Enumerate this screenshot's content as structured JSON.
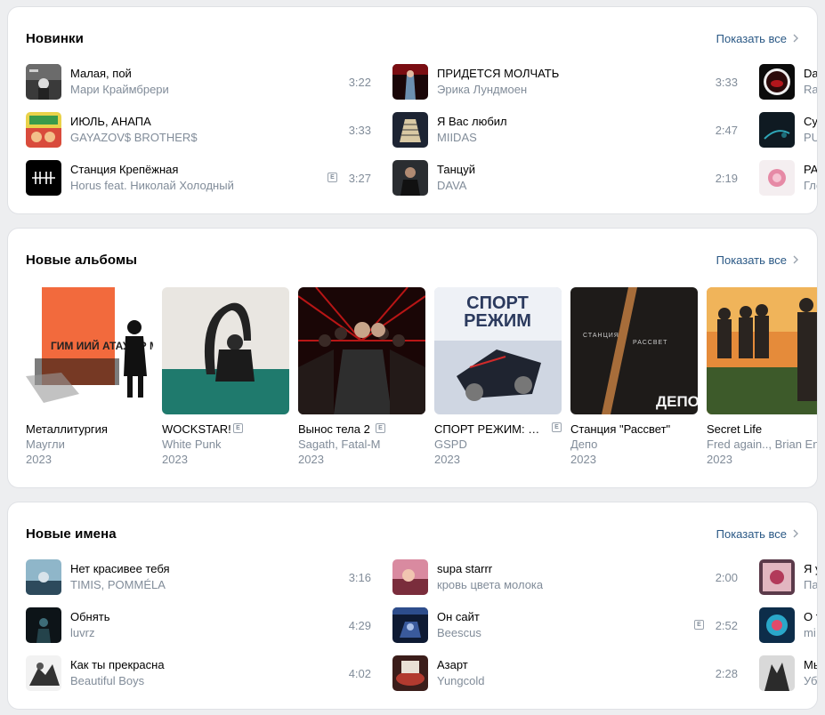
{
  "show_all_label": "Показать все",
  "new_tracks": {
    "title": "Новинки",
    "col1": [
      {
        "title": "Малая, пой",
        "artist": "Мари Краймбрери",
        "duration": "3:22"
      },
      {
        "title": "ИЮЛЬ, АНАПА",
        "artist": "GAYAZOV$ BROTHER$",
        "duration": "3:33"
      },
      {
        "title": "Станция Крепёжная",
        "artist": "Horus feat. Николай Холодный",
        "duration": "3:27",
        "explicit": "E"
      }
    ],
    "col2": [
      {
        "title": "ПРИДЕТСЯ МОЛЧАТЬ",
        "artist": "Эрика Лундмоен",
        "duration": "3:33"
      },
      {
        "title": "Я Вас любил",
        "artist": "MIIDAS",
        "duration": "2:47"
      },
      {
        "title": "Танцуй",
        "artist": "DAVA",
        "duration": "2:19"
      }
    ],
    "col3": [
      {
        "title": "Da",
        "artist": "Ra"
      },
      {
        "title": "Су",
        "artist": "PU"
      },
      {
        "title": "РА",
        "artist": "Гло"
      }
    ]
  },
  "new_albums": {
    "title": "Новые альбомы",
    "items": [
      {
        "title": "Металлитургия",
        "artist": "Маугли",
        "year": "2023"
      },
      {
        "title": "WOCKSTAR!",
        "artist": "White Punk",
        "year": "2023",
        "explicit": "E"
      },
      {
        "title": "Вынос тела 2",
        "artist": "Sagath, Fatal-M",
        "year": "2023",
        "explicit": "E"
      },
      {
        "title": "СПОРТ РЕЖИМ: К…",
        "artist": "GSPD",
        "year": "2023",
        "explicit": "E"
      },
      {
        "title": "Станция \"Рассвет\"",
        "artist": "Депо",
        "year": "2023"
      },
      {
        "title": "Secret Life",
        "artist": "Fred again.., Brian Eno",
        "year": "2023"
      }
    ],
    "cover_texts": {
      "sport_line1": "СПОРТ",
      "sport_line2": "РЕЖИМ",
      "depo_station": "СТАНЦИЯ",
      "depo_dawn": "РАССВЕТ",
      "depo_logo": "ДЕПО",
      "metal_letters": "ГИМ ИИЙ АТАУР Р МЕТАЛЛ"
    }
  },
  "new_names": {
    "title": "Новые имена",
    "col1": [
      {
        "title": "Нет красивее тебя",
        "artist": "TIMIS, POMMÉLA",
        "duration": "3:16"
      },
      {
        "title": "Обнять",
        "artist": "luvrz",
        "duration": "4:29"
      },
      {
        "title": "Как ты прекрасна",
        "artist": "Beautiful Boys",
        "duration": "4:02"
      }
    ],
    "col2": [
      {
        "title": "supa starrr",
        "artist": "кровь цвета молока",
        "duration": "2:00"
      },
      {
        "title": "Он сайт",
        "artist": "Beescus",
        "duration": "2:52",
        "explicit": "E"
      },
      {
        "title": "Азарт",
        "artist": "Yungcold",
        "duration": "2:28"
      }
    ],
    "col3": [
      {
        "title": "Я у",
        "artist": "Па"
      },
      {
        "title": "О т",
        "artist": "mi"
      },
      {
        "title": "Мы",
        "artist": "Уб"
      }
    ]
  },
  "icons": {
    "chevron": "chevron-right-icon"
  },
  "colors": {
    "accent": "#2a5885",
    "secondary_text": "#818c99",
    "background": "#edeef0"
  }
}
